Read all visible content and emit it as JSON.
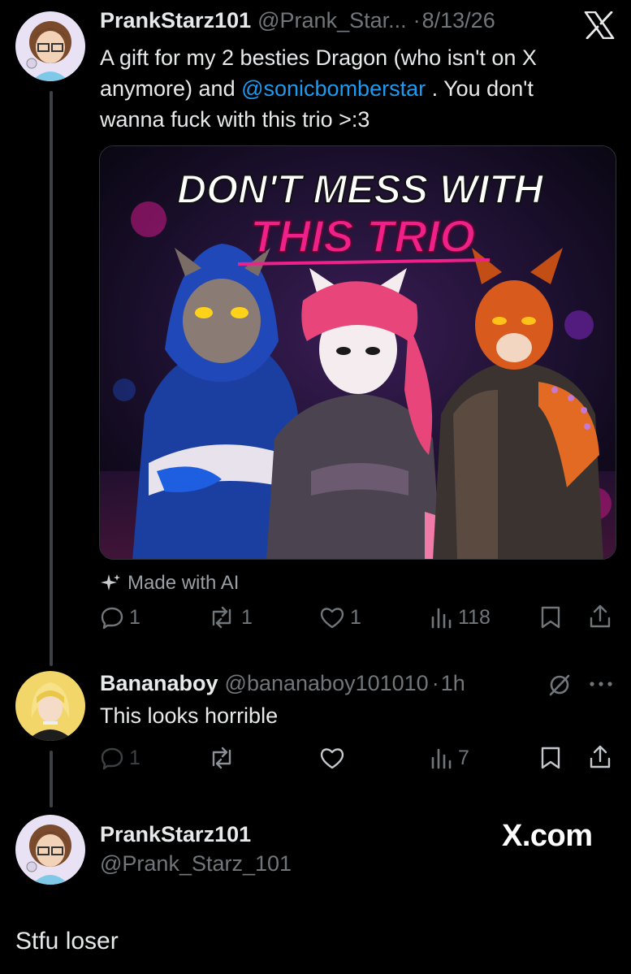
{
  "tweet": {
    "display_name": "PrankStarz101",
    "handle_short": "@Prank_Star...",
    "separator": "·",
    "date": "8/13/26",
    "text_before": "A gift for my 2 besties Dragon (who isn't on X anymore) and ",
    "mention": "@sonicbomberstar",
    "text_after": " . You don't wanna fuck with this trio >:3",
    "image": {
      "title_line1": "DON'T MESS WITH",
      "title_line2": "THIS TRIO"
    },
    "made_with_ai": "Made with AI",
    "stats": {
      "replies": "1",
      "reposts": "1",
      "likes": "1",
      "views": "118"
    }
  },
  "reply": {
    "display_name": "Bananaboy",
    "handle": "@bananaboy101010",
    "separator": "·",
    "time": "1h",
    "text": "This looks horrible",
    "stats": {
      "replies": "1",
      "views": "7"
    }
  },
  "footer": {
    "display_name": "PrankStarz101",
    "handle": "@Prank_Starz_101",
    "brand": "X.com"
  },
  "bottom_reply": {
    "text": "Stfu loser"
  },
  "icons": {
    "x_logo": "x-logo-icon",
    "sparkle": "sparkle-icon",
    "reply": "reply-icon",
    "repost": "repost-icon",
    "like": "heart-icon",
    "views": "views-icon",
    "bookmark": "bookmark-icon",
    "share": "share-icon",
    "grok": "grok-icon",
    "more": "more-icon"
  },
  "colors": {
    "background": "#000000",
    "text": "#e7e9ea",
    "secondary": "#71767b",
    "mention": "#1d9bf0"
  }
}
